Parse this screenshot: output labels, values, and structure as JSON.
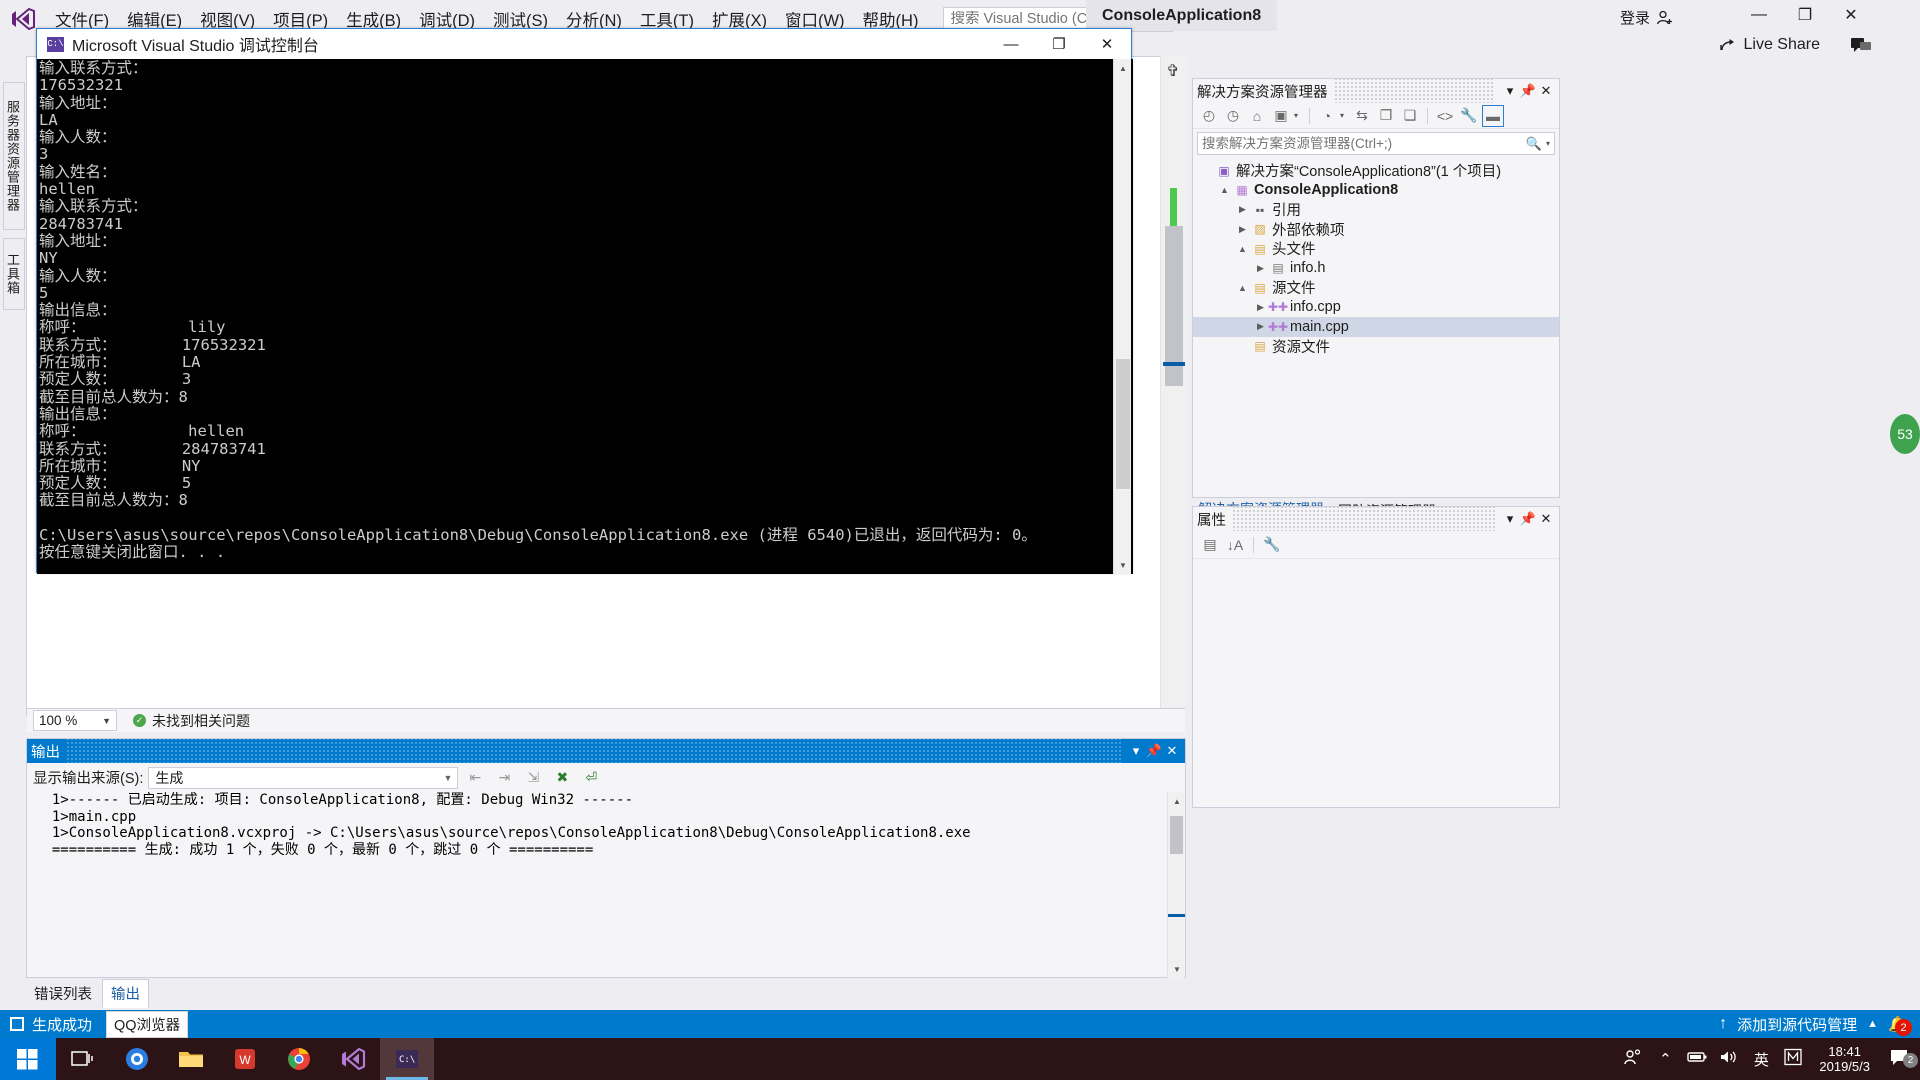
{
  "app": {
    "title_tab": "ConsoleApplication8",
    "signin_label": "登录",
    "live_share_label": "Live Share",
    "menus": [
      "文件(F)",
      "编辑(E)",
      "视图(V)",
      "项目(P)",
      "生成(B)",
      "调试(D)",
      "测试(S)",
      "分析(N)",
      "工具(T)",
      "扩展(X)",
      "窗口(W)",
      "帮助(H)"
    ],
    "quick_search_placeholder": "搜索 Visual Studio (Ctrl+Q)",
    "window_buttons": {
      "minimize": "—",
      "maximize": "❐",
      "close": "✕"
    }
  },
  "left_tabs": {
    "server_explorer": "服务器资源管理器",
    "toolbox": "工具箱"
  },
  "console": {
    "title": "Microsoft Visual Studio 调试控制台",
    "icon_label": "C:\\",
    "window_buttons": {
      "minimize": "—",
      "maximize": "❐",
      "close": "✕"
    },
    "text": "输入联系方式：\n176532321\n输入地址：\nLA\n输入人数：\n3\n输入姓名：\nhellen\n输入联系方式：\n284783741\n输入地址：\nNY\n输入人数：\n5\n输出信息：\n称呼：           lily\n联系方式：       176532321\n所在城市：       LA\n预定人数：       3\n截至目前总人数为：8\n输出信息：\n称呼：           hellen\n联系方式：       284783741\n所在城市：       NY\n预定人数：       5\n截至目前总人数为：8\n\nC:\\Users\\asus\\source\\repos\\ConsoleApplication8\\Debug\\ConsoleApplication8.exe (进程 6540)已退出，返回代码为: 0。\n按任意键关闭此窗口. . ."
  },
  "editor_status": {
    "zoom": "100 %",
    "issues": "未找到相关问题"
  },
  "solution_explorer": {
    "title": "解决方案资源管理器",
    "search_placeholder": "搜索解决方案资源管理器(Ctrl+;)",
    "tree": [
      {
        "label": "解决方案“ConsoleApplication8”(1 个项目)",
        "indent": 0,
        "expander": "",
        "icon": "solution-icon",
        "glyph": "▣",
        "color": "#8b5cc7",
        "bold": false,
        "selected": false
      },
      {
        "label": "ConsoleApplication8",
        "indent": 1,
        "expander": "▲",
        "icon": "project-icon",
        "glyph": "▦",
        "color": "#b07ad6",
        "bold": true,
        "selected": false
      },
      {
        "label": "引用",
        "indent": 2,
        "expander": "▶",
        "icon": "references-icon",
        "glyph": "▪▪",
        "color": "#5a5a5a",
        "bold": false,
        "selected": false
      },
      {
        "label": "外部依赖项",
        "indent": 2,
        "expander": "▶",
        "icon": "dependencies-icon",
        "glyph": "▨",
        "color": "#d9a441",
        "bold": false,
        "selected": false
      },
      {
        "label": "头文件",
        "indent": 2,
        "expander": "▲",
        "icon": "folder-icon",
        "glyph": "▤",
        "color": "#d9a441",
        "bold": false,
        "selected": false
      },
      {
        "label": "info.h",
        "indent": 3,
        "expander": "▶",
        "icon": "header-file-icon",
        "glyph": "▤",
        "color": "#7a7a7a",
        "bold": false,
        "selected": false
      },
      {
        "label": "源文件",
        "indent": 2,
        "expander": "▲",
        "icon": "folder-icon",
        "glyph": "▤",
        "color": "#d9a441",
        "bold": false,
        "selected": false
      },
      {
        "label": "info.cpp",
        "indent": 3,
        "expander": "▶",
        "icon": "cpp-file-icon",
        "glyph": "✚✚",
        "color": "#b07ad6",
        "bold": false,
        "selected": false
      },
      {
        "label": "main.cpp",
        "indent": 3,
        "expander": "▶",
        "icon": "cpp-file-icon",
        "glyph": "✚✚",
        "color": "#b07ad6",
        "bold": false,
        "selected": true
      },
      {
        "label": "资源文件",
        "indent": 2,
        "expander": "",
        "icon": "folder-icon",
        "glyph": "▤",
        "color": "#d9a441",
        "bold": false,
        "selected": false
      }
    ],
    "tabs": [
      {
        "label": "解决方案资源管理器",
        "active": true
      },
      {
        "label": "团队资源管理器",
        "active": false
      }
    ]
  },
  "properties_panel": {
    "title": "属性"
  },
  "output_panel": {
    "title": "输出",
    "source_label": "显示输出来源(S):",
    "source_value": "生成",
    "text": "  1>------ 已启动生成: 项目: ConsoleApplication8, 配置: Debug Win32 ------\n  1>main.cpp\n  1>ConsoleApplication8.vcxproj -> C:\\Users\\asus\\source\\repos\\ConsoleApplication8\\Debug\\ConsoleApplication8.exe\n  ========== 生成: 成功 1 个，失败 0 个，最新 0 个，跳过 0 个 =========="
  },
  "doc_tabs": [
    {
      "label": "错误列表",
      "active": false
    },
    {
      "label": "输出",
      "active": true
    }
  ],
  "status_bar": {
    "state": "生成成功",
    "chip": "QQ浏览器",
    "source_control": "添加到源代码管理",
    "notification_count": "2"
  },
  "taskbar": {
    "clock_time": "18:41",
    "clock_date": "2019/5/3",
    "ime": "英",
    "action_center_count": "2"
  },
  "misc": {
    "side_badge": "53"
  },
  "colors": {
    "accent": "#007acc",
    "selection": "#cfd6e5",
    "console_bg": "#000000",
    "console_fg": "#cccccc",
    "taskbar_bg": "#2b1316",
    "start_blue": "#0078d7",
    "badge_red": "#e51400"
  }
}
